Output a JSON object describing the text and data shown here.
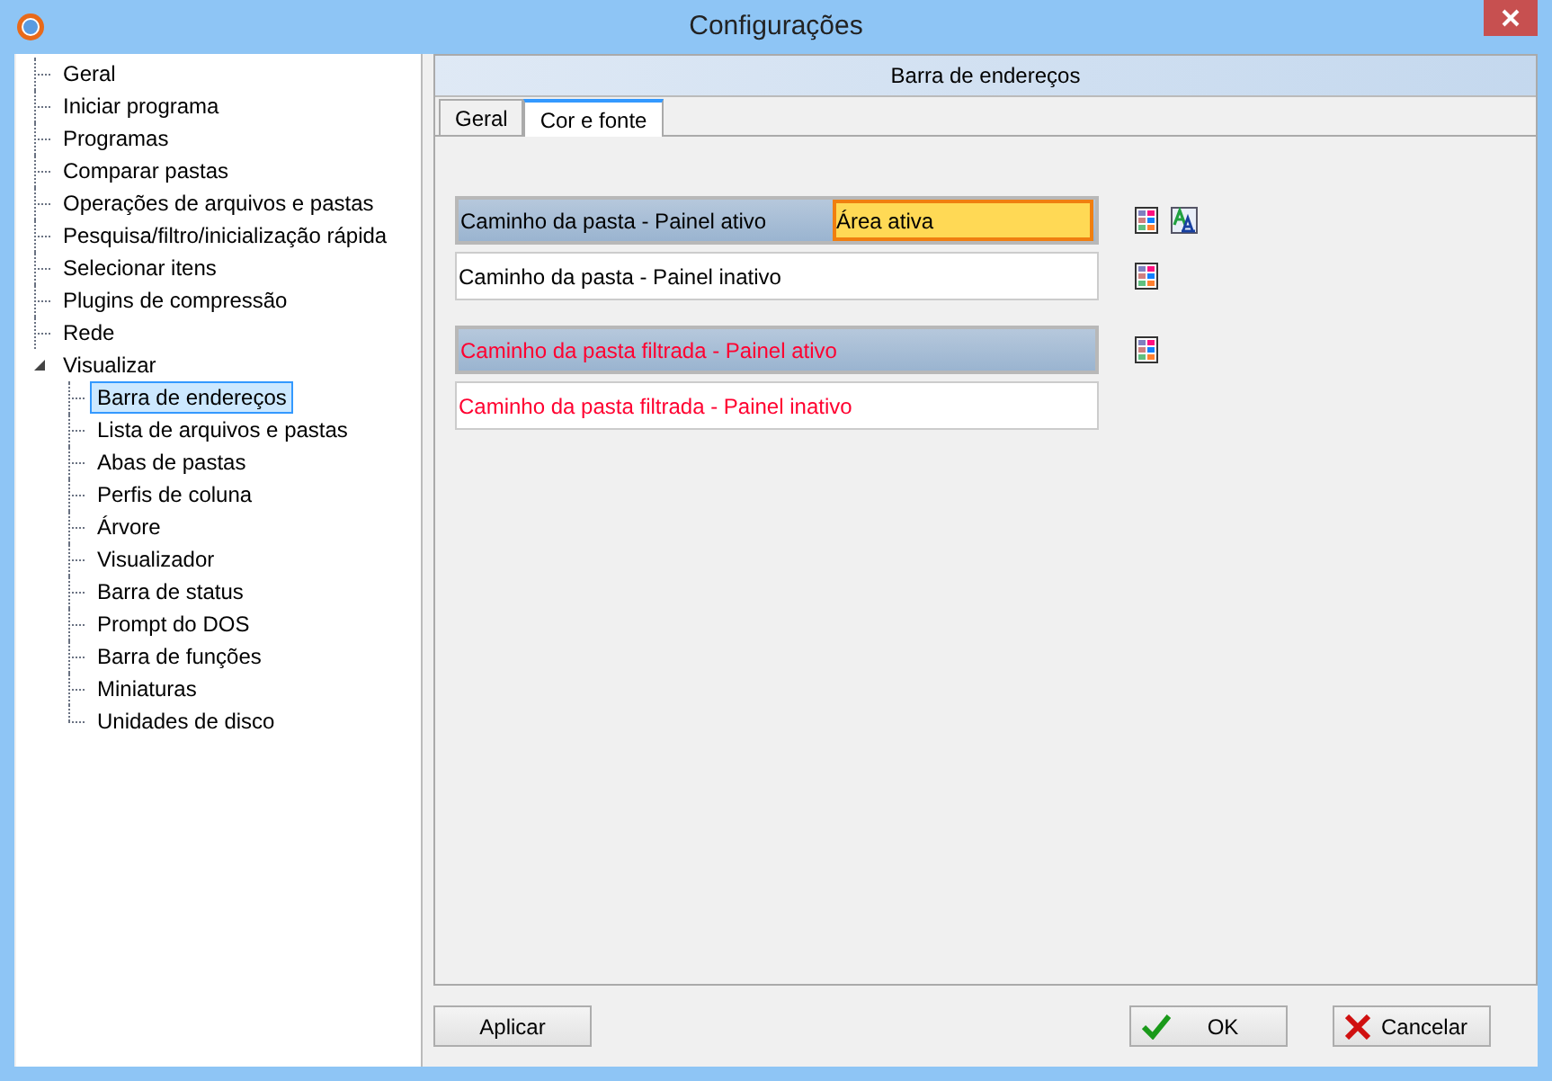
{
  "window": {
    "title": "Configurações"
  },
  "tree": [
    {
      "label": "Geral",
      "selected": false
    },
    {
      "label": "Iniciar programa",
      "selected": false
    },
    {
      "label": "Programas",
      "selected": false
    },
    {
      "label": "Comparar pastas",
      "selected": false
    },
    {
      "label": "Operações de arquivos e pastas",
      "selected": false
    },
    {
      "label": "Pesquisa/filtro/inicialização rápida",
      "selected": false
    },
    {
      "label": "Selecionar itens",
      "selected": false
    },
    {
      "label": "Plugins de compressão",
      "selected": false
    },
    {
      "label": "Rede",
      "selected": false
    },
    {
      "label": "Visualizar",
      "selected": false,
      "expanded": true,
      "children": [
        {
          "label": "Barra de endereços",
          "selected": true
        },
        {
          "label": "Lista de arquivos e pastas",
          "selected": false
        },
        {
          "label": "Abas de pastas",
          "selected": false
        },
        {
          "label": "Perfis de coluna",
          "selected": false
        },
        {
          "label": "Árvore",
          "selected": false
        },
        {
          "label": "Visualizador",
          "selected": false
        },
        {
          "label": "Barra de status",
          "selected": false
        },
        {
          "label": "Prompt do DOS",
          "selected": false
        },
        {
          "label": "Barra de funções",
          "selected": false
        },
        {
          "label": "Miniaturas",
          "selected": false
        },
        {
          "label": "Unidades de disco",
          "selected": false
        }
      ]
    }
  ],
  "panel": {
    "title": "Barra de endereços",
    "tabs": [
      {
        "label": "Geral",
        "selected": false
      },
      {
        "label": "Cor e fonte",
        "selected": true
      }
    ],
    "rows": [
      {
        "label": "Caminho da pasta - Painel ativo",
        "active": true,
        "color": "#000000",
        "sample": "Área ativa",
        "color_picker": true,
        "font_picker": true
      },
      {
        "label": "Caminho da pasta - Painel inativo",
        "active": false,
        "color": "#000000",
        "color_picker": true,
        "font_picker": false
      },
      {
        "label": "Caminho da pasta filtrada - Painel ativo",
        "active": true,
        "color": "#ff0030",
        "color_picker": true,
        "font_picker": false
      },
      {
        "label": "Caminho da pasta filtrada - Painel inativo",
        "active": false,
        "color": "#ff0030",
        "color_picker": false,
        "font_picker": false
      }
    ]
  },
  "buttons": [
    {
      "label": "Aplicar",
      "kind": "plain"
    },
    {
      "label": "OK",
      "kind": "ok"
    },
    {
      "label": "Cancelar",
      "kind": "cancel"
    }
  ]
}
